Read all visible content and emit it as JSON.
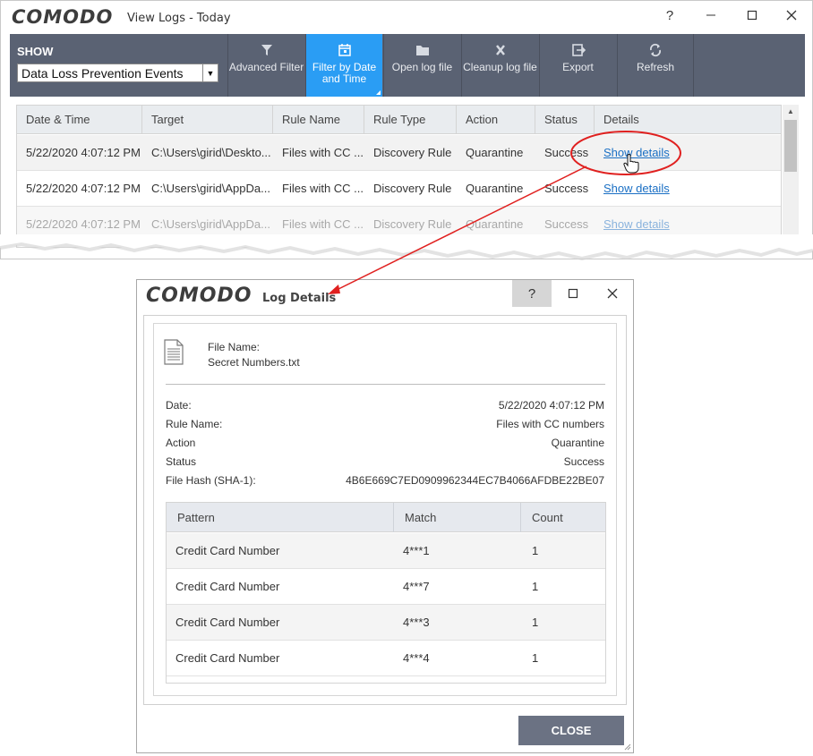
{
  "main_window": {
    "logo": "COMODO",
    "title": "View Logs - Today",
    "help": "?",
    "show_label": "SHOW",
    "show_selected": "Data Loss Prevention Events",
    "toolbar": {
      "advanced_filter": "Advanced Filter",
      "filter_date_time": "Filter by Date and Time",
      "open_log_file": "Open log file",
      "cleanup_log_file": "Cleanup log file",
      "export": "Export",
      "refresh": "Refresh"
    },
    "columns": [
      "Date & Time",
      "Target",
      "Rule Name",
      "Rule Type",
      "Action",
      "Status",
      "Details"
    ],
    "rows": [
      {
        "date": "5/22/2020 4:07:12 PM",
        "target": "C:\\Users\\girid\\Deskto...",
        "rule_name": "Files with CC ...",
        "rule_type": "Discovery Rule",
        "action": "Quarantine",
        "status": "Success",
        "details": "Show details"
      },
      {
        "date": "5/22/2020 4:07:12 PM",
        "target": "C:\\Users\\girid\\AppDa...",
        "rule_name": "Files with CC ...",
        "rule_type": "Discovery Rule",
        "action": "Quarantine",
        "status": "Success",
        "details": "Show details"
      },
      {
        "date": "5/22/2020 4:07:12 PM",
        "target": "C:\\Users\\girid\\AppDa...",
        "rule_name": "Files with CC ...",
        "rule_type": "Discovery Rule",
        "action": "Quarantine",
        "status": "Success",
        "details": "Show details"
      }
    ]
  },
  "log_details": {
    "logo": "COMODO",
    "title": "Log Details",
    "help": "?",
    "file_name_label": "File Name:",
    "file_name": "Secret Numbers.txt",
    "fields": [
      {
        "label": "Date:",
        "value": "5/22/2020 4:07:12 PM"
      },
      {
        "label": "Rule Name:",
        "value": "Files with CC numbers"
      },
      {
        "label": "Action",
        "value": "Quarantine"
      },
      {
        "label": "Status",
        "value": "Success"
      },
      {
        "label": "File Hash (SHA-1):",
        "value": "4B6E669C7ED0909962344EC7B4066AFDBE22BE07"
      }
    ],
    "table": {
      "headers": [
        "Pattern",
        "Match",
        "Count"
      ],
      "rows": [
        {
          "pattern": "Credit Card Number",
          "match": "4***1",
          "count": "1"
        },
        {
          "pattern": "Credit Card Number",
          "match": "4***7",
          "count": "1"
        },
        {
          "pattern": "Credit Card Number",
          "match": "4***3",
          "count": "1"
        },
        {
          "pattern": "Credit Card Number",
          "match": "4***4",
          "count": "1"
        }
      ]
    },
    "close_label": "CLOSE"
  },
  "colors": {
    "toolbar_bg": "#5a6273",
    "active_tab": "#2a9df4",
    "link": "#1a6fc4",
    "annotation": "#e0201f",
    "close_button": "#6b7283"
  }
}
